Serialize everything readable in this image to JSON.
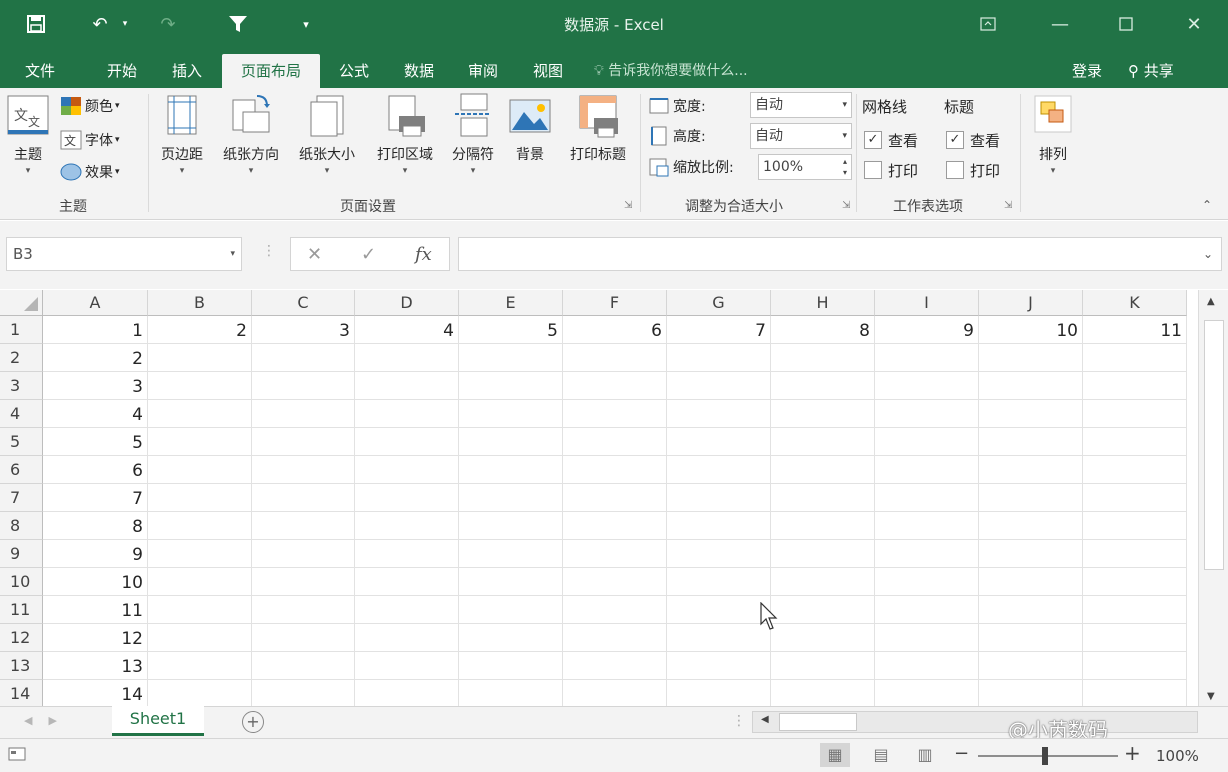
{
  "window": {
    "title": "数据源 - Excel"
  },
  "tabs": [
    "文件",
    "开始",
    "插入",
    "页面布局",
    "公式",
    "数据",
    "审阅",
    "视图"
  ],
  "tell_me": "告诉我你想要做什么...",
  "login": "登录",
  "share": "共享",
  "ribbon": {
    "theme_group": {
      "label": "主题",
      "main": "主题",
      "colors": "颜色",
      "fonts": "字体",
      "effects": "效果"
    },
    "page_setup_group": {
      "label": "页面设置",
      "buttons": [
        "页边距",
        "纸张方向",
        "纸张大小",
        "打印区域",
        "分隔符",
        "背景",
        "打印标题"
      ]
    },
    "scale_group": {
      "label": "调整为合适大小",
      "width_label": "宽度:",
      "width_value": "自动",
      "height_label": "高度:",
      "height_value": "自动",
      "scale_label": "缩放比例:",
      "scale_value": "100%"
    },
    "sheet_options_group": {
      "label": "工作表选项",
      "gridlines": "网格线",
      "headings": "标题",
      "view": "查看",
      "print": "打印"
    },
    "arrange": "排列"
  },
  "formula_bar": {
    "name_box": "B3",
    "fx": "fx",
    "formula": ""
  },
  "grid": {
    "columns": [
      "A",
      "B",
      "C",
      "D",
      "E",
      "F",
      "G",
      "H",
      "I",
      "J",
      "K"
    ],
    "rows": [
      "1",
      "2",
      "3",
      "4",
      "5",
      "6",
      "7",
      "8",
      "9",
      "10",
      "11",
      "12",
      "13",
      "14"
    ],
    "row1_values": [
      "1",
      "2",
      "3",
      "4",
      "5",
      "6",
      "7",
      "8",
      "9",
      "10",
      "11"
    ],
    "colA_values": [
      "1",
      "2",
      "3",
      "4",
      "5",
      "6",
      "7",
      "8",
      "9",
      "10",
      "11",
      "12",
      "13",
      "14"
    ]
  },
  "sheet_tabs": [
    "Sheet1"
  ],
  "status": {
    "zoom": "100%"
  },
  "watermark": "@小芮数码",
  "colors": {
    "accent": "#217346",
    "ribbon_bg": "#f3f3f3",
    "grid_line": "#e2e2e2"
  }
}
